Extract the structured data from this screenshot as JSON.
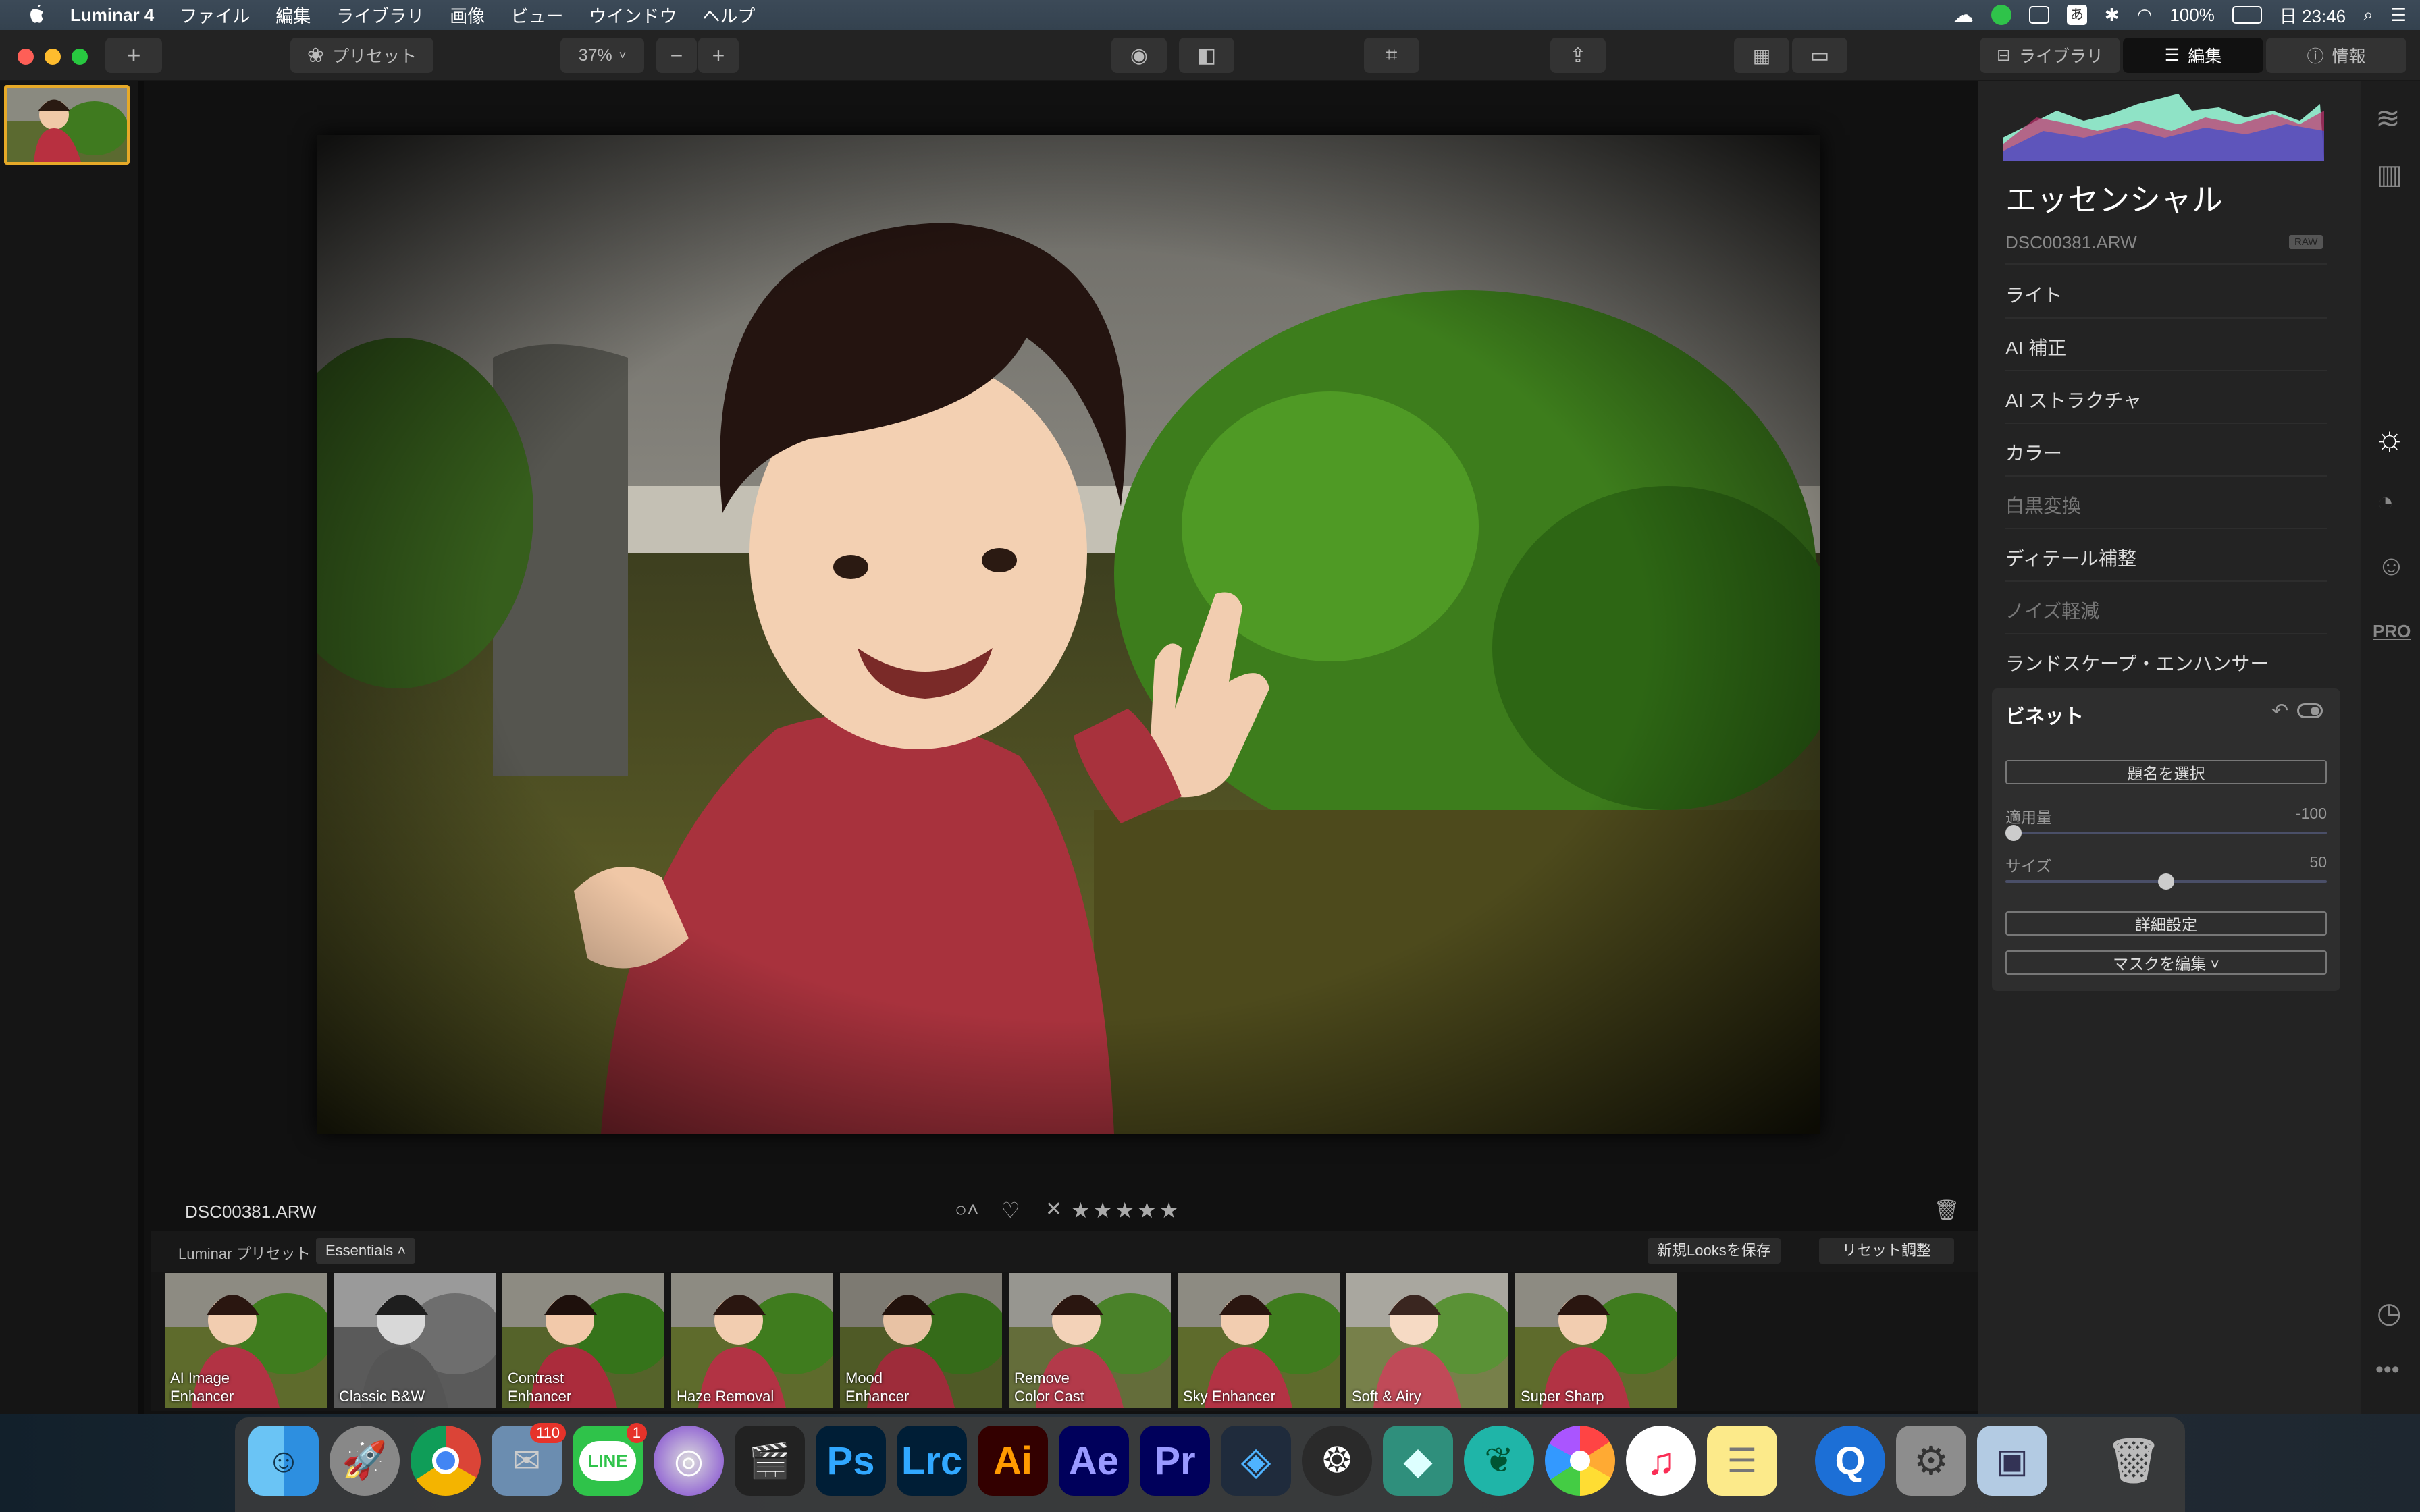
{
  "menubar": {
    "app": "Luminar 4",
    "items": [
      "ファイル",
      "編集",
      "ライブラリ",
      "画像",
      "ビュー",
      "ウインドウ",
      "ヘルプ"
    ],
    "battery": "100%",
    "clock": "日 23:46"
  },
  "toolbar": {
    "presets": "プリセット",
    "zoom": "37%",
    "zoom_out": "−",
    "zoom_in": "+",
    "tab_library": "ライブラリ",
    "tab_edit": "編集",
    "tab_info": "情報"
  },
  "panel": {
    "title": "エッセンシャル",
    "filename": "DSC00381.ARW",
    "raw_badge": "RAW",
    "tools": [
      {
        "label": "ライト",
        "enabled": true
      },
      {
        "label": "AI 補正",
        "enabled": true
      },
      {
        "label": "AI ストラクチャ",
        "enabled": true
      },
      {
        "label": "カラー",
        "enabled": true
      },
      {
        "label": "白黒変換",
        "enabled": false
      },
      {
        "label": "ディテール補整",
        "enabled": true
      },
      {
        "label": "ノイズ軽減",
        "enabled": false
      },
      {
        "label": "ランドスケープ・エンハンサー",
        "enabled": true
      }
    ],
    "vignette": {
      "title": "ビネット",
      "select_subject": "題名を選択",
      "amount_label": "適用量",
      "amount_value": "-100",
      "amount_pos": 0.0,
      "size_label": "サイズ",
      "size_value": "50",
      "size_pos": 0.5,
      "advanced": "詳細設定",
      "edit_mask": "マスクを編集 ˅"
    }
  },
  "info": {
    "filename": "DSC00381.ARW"
  },
  "presetbar": {
    "label": "Luminar プリセット",
    "collection": "Essentials ˄",
    "save_looks": "新規Looksを保存",
    "reset": "リセット調整"
  },
  "presets": [
    "AI Image Enhancer",
    "Classic B&W",
    "Contrast Enhancer",
    "Haze Removal",
    "Mood Enhancer",
    "Remove Color Cast",
    "Sky Enhancer",
    "Soft & Airy",
    "Super Sharp"
  ],
  "dock": {
    "apps": [
      "Finder",
      "Launchpad",
      "Chrome",
      "Mail",
      "LINE",
      "Motion",
      "Final Cut Pro",
      "Photoshop",
      "Lightroom Classic",
      "Illustrator",
      "After Effects",
      "Premiere Pro",
      "Layers",
      "DaVinci Resolve",
      "Filmora",
      "MindNode",
      "Photos",
      "Music",
      "Notes",
      "QuickTime",
      "System Preferences",
      "Preview",
      "Trash"
    ],
    "mail_badge": "110",
    "line_badge": "1",
    "ps": "Ps",
    "lrc": "Lrc",
    "ai": "Ai",
    "ae": "Ae",
    "pr": "Pr",
    "line_text": "LINE"
  }
}
